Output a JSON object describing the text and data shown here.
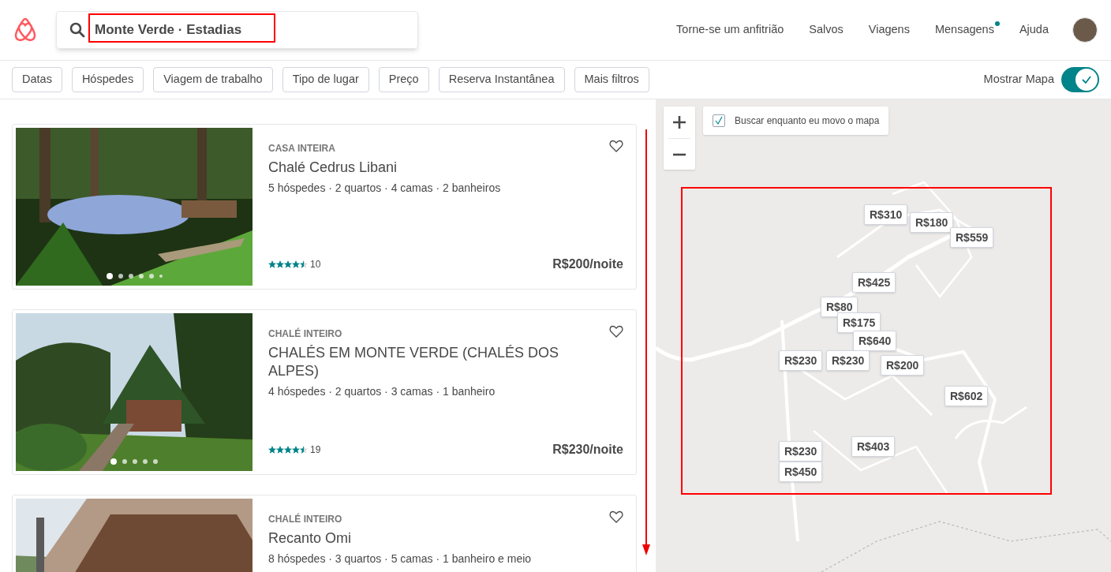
{
  "header": {
    "search": {
      "value": "Monte Verde · Estadias"
    },
    "nav": [
      {
        "label": "Torne-se um anfitrião",
        "unread": false
      },
      {
        "label": "Salvos",
        "unread": false
      },
      {
        "label": "Viagens",
        "unread": false
      },
      {
        "label": "Mensagens",
        "unread": true
      },
      {
        "label": "Ajuda",
        "unread": false
      }
    ]
  },
  "filters": [
    "Datas",
    "Hóspedes",
    "Viagem de trabalho",
    "Tipo de lugar",
    "Preço",
    "Reserva Instantânea",
    "Mais filtros"
  ],
  "map_toggle": {
    "label": "Mostrar Mapa",
    "on": true
  },
  "listings": [
    {
      "type": "CASA INTEIRA",
      "title": "Chalé Cedrus Libani",
      "details": "5 hóspedes · 2 quartos · 4 camas · 2 banheiros",
      "stars": 4.5,
      "reviews": "10",
      "price": "R$200/noite",
      "saved": false,
      "photo": {
        "kind": "picture"
      },
      "dots": [
        {
          "selected": true
        },
        {
          "selected": false
        },
        {
          "selected": false
        },
        {
          "selected": false
        },
        {
          "selected": false
        },
        {
          "selected": false
        }
      ]
    },
    {
      "type": "CHALÉ INTEIRO",
      "title": "CHALÉS EM MONTE VERDE (CHALÉS DOS ALPES)",
      "details": "4 hóspedes · 2 quartos · 3 camas · 1 banheiro",
      "stars": 4.5,
      "reviews": "19",
      "price": "R$230/noite",
      "saved": false,
      "photo": {
        "kind": "picture"
      },
      "dots": [
        {
          "selected": true
        },
        {
          "selected": false
        },
        {
          "selected": false
        },
        {
          "selected": false
        },
        {
          "selected": false
        }
      ]
    },
    {
      "type": "CHALÉ INTEIRO",
      "title": "Recanto Omi",
      "details": "8 hóspedes · 3 quartos · 5 camas · 1 banheiro e meio",
      "saved": false,
      "photo": {
        "kind": "picture"
      }
    }
  ],
  "map": {
    "search_as_move": {
      "label": "Buscar enquanto eu movo o mapa",
      "checked": true
    },
    "markers": [
      "R$310",
      "R$180",
      "R$559",
      "R$425",
      "R$80",
      "R$175",
      "R$640",
      "R$230",
      "R$230",
      "R$200",
      "R$602",
      "R$403",
      "R$230",
      "R$450"
    ]
  }
}
